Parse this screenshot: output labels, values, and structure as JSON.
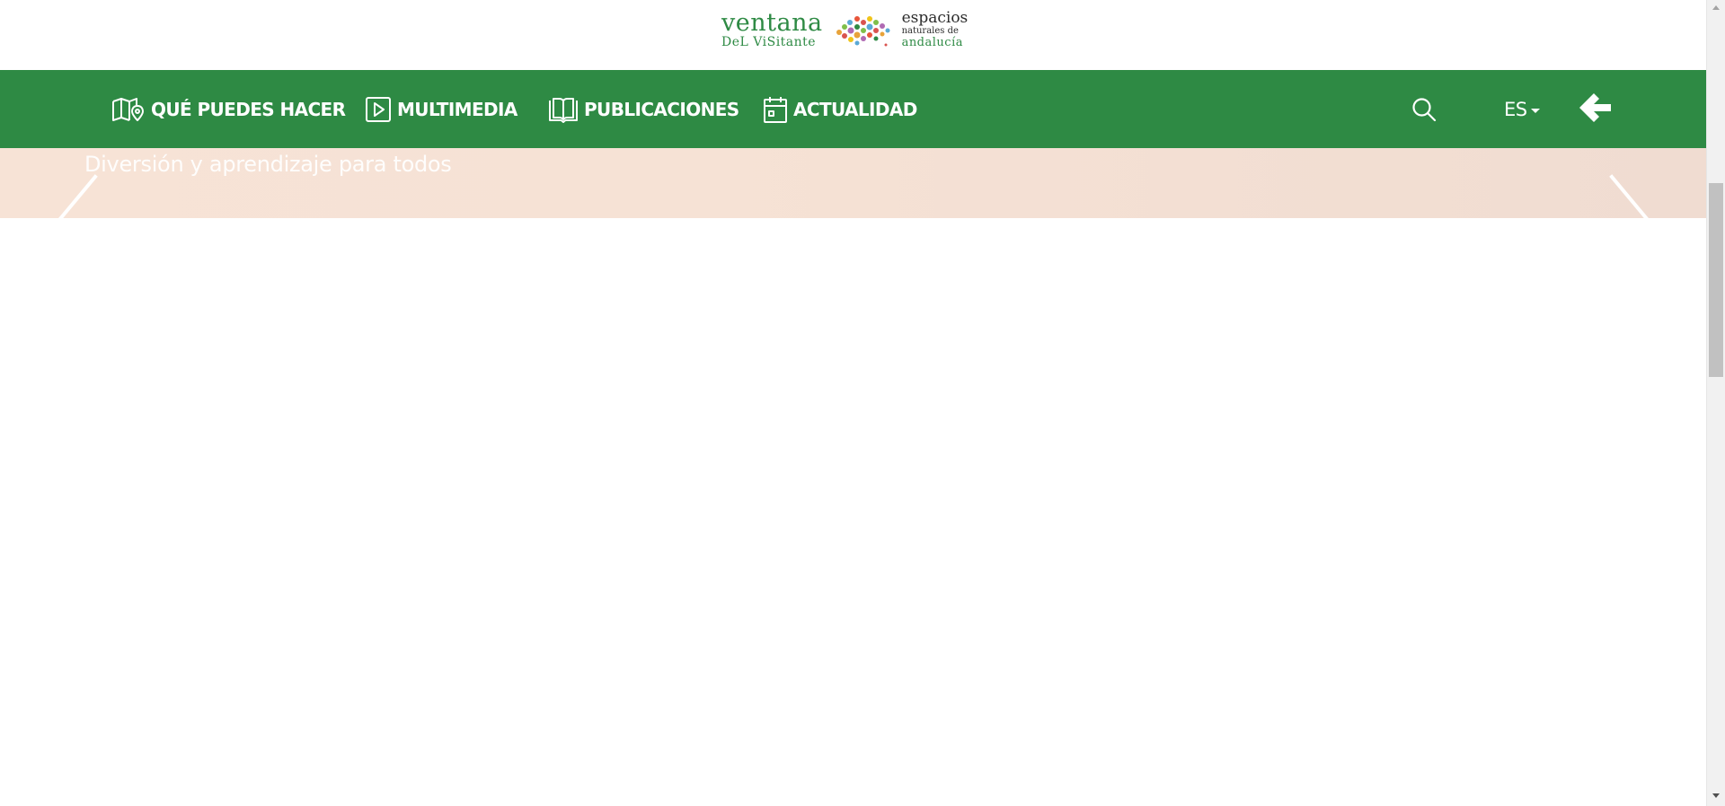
{
  "logo": {
    "line1": "ventana",
    "line2": "DeL ViSitante",
    "right_line1": "espacios",
    "right_line2": "naturales de",
    "right_line3": "andalucía",
    "brand_green": "#2e8a44"
  },
  "nav": {
    "background": "#2e8a44",
    "items": [
      {
        "label": "QUÉ PUEDES HACER",
        "icon": "map-pin-icon"
      },
      {
        "label": "MULTIMEDIA",
        "icon": "play-icon"
      },
      {
        "label": "PUBLICACIONES",
        "icon": "book-icon"
      },
      {
        "label": "ACTUALIDAD",
        "icon": "calendar-icon"
      }
    ],
    "search_icon": "search-icon",
    "language": "ES",
    "back_icon": "arrow-left-icon"
  },
  "hero": {
    "caption": "Diversión y aprendizaje para todos",
    "prev_icon": "chevron-left-icon",
    "next_icon": "chevron-right-icon"
  }
}
